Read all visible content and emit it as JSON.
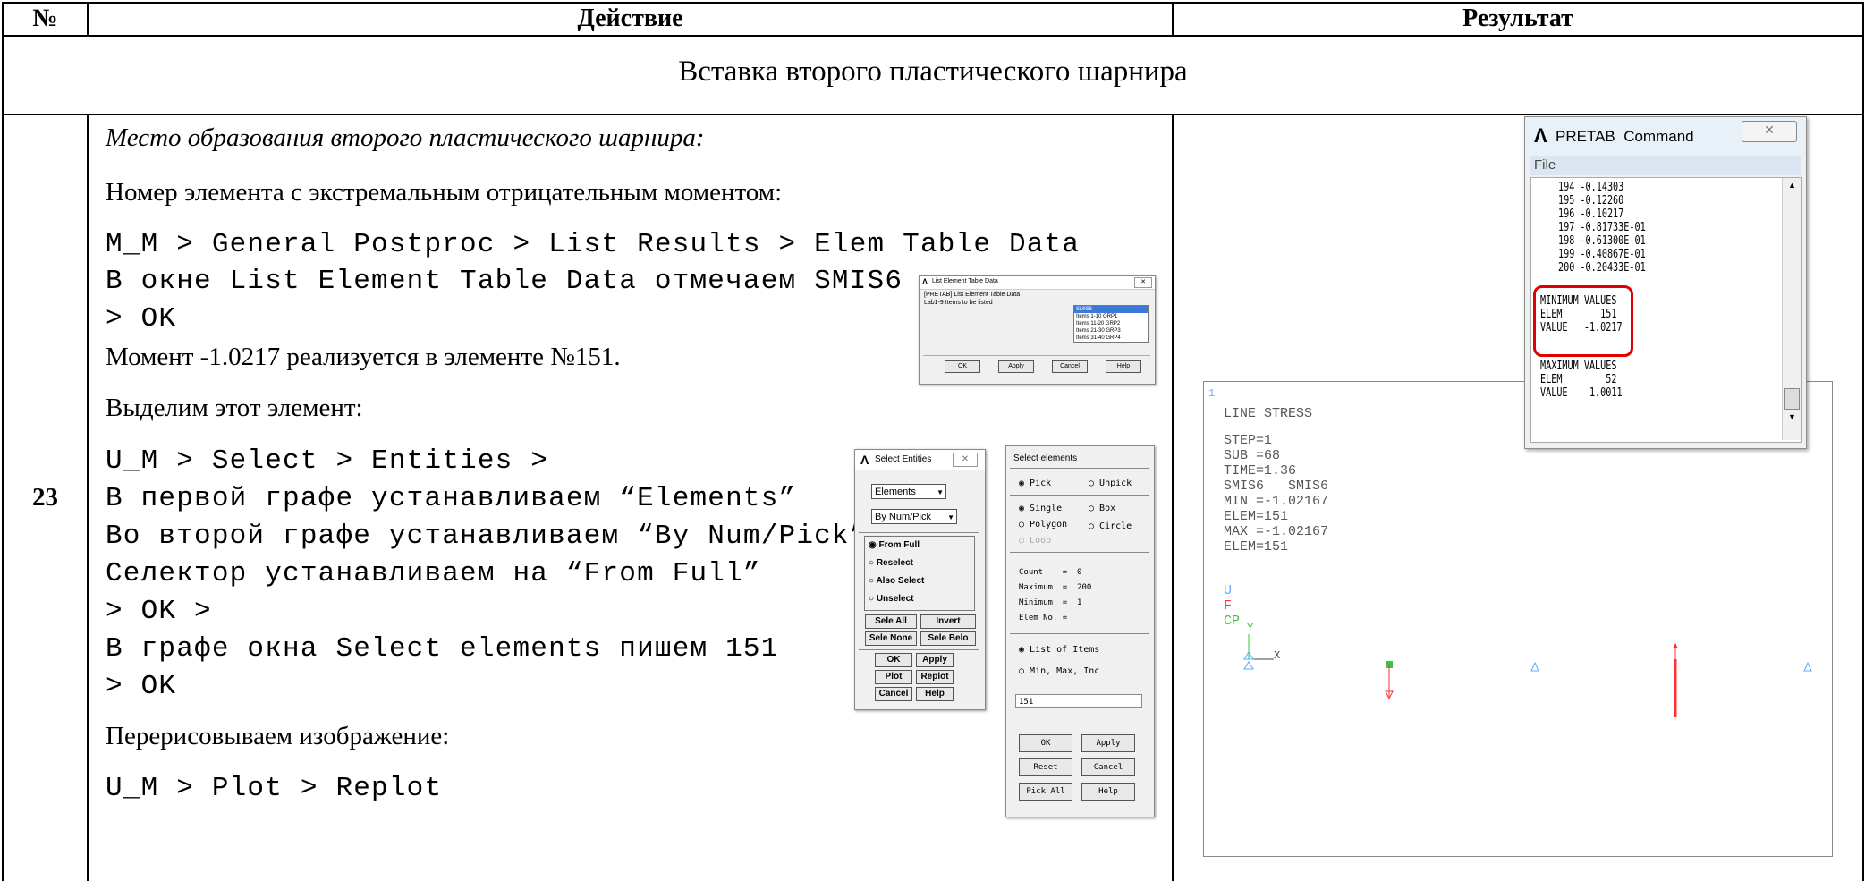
{
  "header": {
    "num": "№",
    "action": "Действие",
    "result": "Результат"
  },
  "section_title": "Вставка второго пластического шарнира",
  "row_number": "23",
  "action_lines": [
    "Место образования второго пластического шарнира:",
    "Номер элемента с экстремальным отрицательным моментом:",
    "M_M > General Postproc > List Results > Elem Table Data",
    "В окне List Element Table Data отмечаем SMIS6",
    "> OK",
    "Момент -1.0217 реализуется в элементе №151.",
    "Выделим этот элемент:",
    "U_M > Select > Entities >",
    "В первой графе устанавливаем “Elements”",
    "Во второй графе устанавливаем “By Num/Pick”",
    "Селектор устанавливаем на “From Full”",
    "> OK >",
    "В графе окна Select elements пишем 151",
    "> OK",
    "Перерисовываем изображение:",
    "U_M > Plot > Replot"
  ],
  "list_table_dialog": {
    "title": "List Element Table Data",
    "caption": "[PRETAB] List Element Table Data",
    "field_label": "Lab1-9  Items to be listed",
    "items": [
      "SMIS6",
      "Items 1-10 GRP1",
      "Items 11-20 GRP2",
      "Items 21-30 GRP3",
      "Items 31-40 GRP4"
    ],
    "buttons": [
      "OK",
      "Apply",
      "Cancel",
      "Help"
    ]
  },
  "select_entities": {
    "title": "Select Entities",
    "dropdown1": "Elements",
    "dropdown2": "By Num/Pick",
    "radios": [
      "From Full",
      "Reselect",
      "Also Select",
      "Unselect"
    ],
    "buttons": [
      "Sele All",
      "Invert",
      "Sele None",
      "Sele Belo",
      "OK",
      "Apply",
      "Plot",
      "Replot",
      "Cancel",
      "Help"
    ]
  },
  "select_elements": {
    "title": "Select elements",
    "pick": "Pick",
    "unpick": "Unpick",
    "single": "Single",
    "box": "Box",
    "polygon": "Polygon",
    "circle": "Circle",
    "loop": "Loop",
    "count": "Count    =  0",
    "maximum": "Maximum  =  200",
    "minimum": "Minimum  =  1",
    "elemno": "Elem No. =",
    "list_items": "List of Items",
    "minmax": "Min, Max, Inc",
    "input_value": "151",
    "buttons": [
      "OK",
      "Apply",
      "Reset",
      "Cancel",
      "Pick All",
      "Help"
    ]
  },
  "ansys_plot": {
    "corner": "1",
    "title": "LINE STRESS",
    "lines": [
      "STEP=1",
      "SUB =68",
      "TIME=1.36",
      "SMIS6   SMIS6",
      "MIN =-1.02167",
      "ELEM=151",
      "MAX =-1.02167",
      "ELEM=151"
    ],
    "legend": [
      "U",
      "F",
      "CP"
    ],
    "axis_y": "Y",
    "axis_x": "X",
    "colors": {
      "U": "#5fa8ff",
      "F": "#ff3030",
      "CP": "#40c040"
    }
  },
  "pretab": {
    "title": "PRETAB  Command",
    "menu": "File",
    "rows": [
      "194 -0.14303",
      "195 -0.12260",
      "196 -0.10217",
      "197 -0.81733E-01",
      "198 -0.61300E-01",
      "199 -0.40867E-01",
      "200 -0.20433E-01"
    ],
    "min_label": "MINIMUM VALUES",
    "min_elem": "ELEM       151",
    "min_value": "VALUE   -1.0217",
    "max_label": "MAXIMUM VALUES",
    "max_elem": "ELEM        52",
    "max_value": "VALUE    1.0011",
    "highlight_color": "#e00000"
  }
}
